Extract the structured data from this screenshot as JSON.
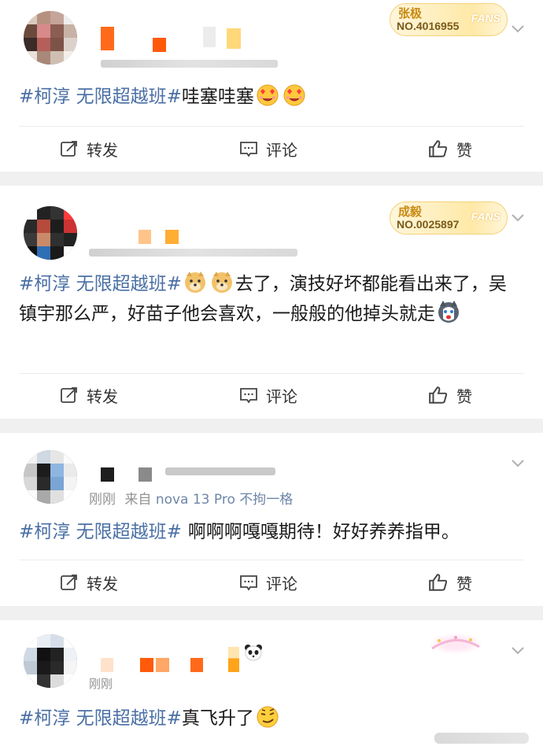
{
  "posts": [
    {
      "fans_badge": {
        "name": "张极",
        "number": "NO.4016955",
        "word": "FANS"
      },
      "meta": {
        "time": "",
        "source": ""
      },
      "hashtag": "#柯淳 无限超越班#",
      "text": "哇塞哇塞",
      "emojis": [
        "heart-eyes-emoji",
        "heart-eyes-emoji"
      ],
      "actions": {
        "repost": "转发",
        "comment": "评论",
        "like": "赞"
      }
    },
    {
      "fans_badge": {
        "name": "成毅",
        "number": "NO.0025897",
        "word": "FANS"
      },
      "meta": {
        "time": "",
        "source": ""
      },
      "hashtag": "#柯淳 无限超越班#",
      "text": "去了，演技好坏都能看出来了，吴镇宇那么严，好苗子他会喜欢，一般般的他掉头就走",
      "emojis": [
        "doge-emoji",
        "doge-emoji",
        "husky-emoji"
      ],
      "actions": {
        "repost": "转发",
        "comment": "评论",
        "like": "赞"
      }
    },
    {
      "meta": {
        "time": "刚刚",
        "source_prefix": "来自",
        "source": "nova 13 Pro 不拘一格"
      },
      "hashtag": "#柯淳 无限超越班#",
      "text": "啊啊啊嘎嘎期待！好好养养指甲。",
      "actions": {
        "repost": "转发",
        "comment": "评论",
        "like": "赞"
      }
    },
    {
      "meta": {
        "time": "刚刚"
      },
      "hashtag": "#柯淳 无限超越班#",
      "text": "真飞升了",
      "emojis": [
        "smirk-emoji"
      ]
    }
  ],
  "colors": {
    "hashtag": "#4a6fa5",
    "source_link": "#6e86a8",
    "meta": "#939393",
    "background": "#f0f0f0"
  }
}
